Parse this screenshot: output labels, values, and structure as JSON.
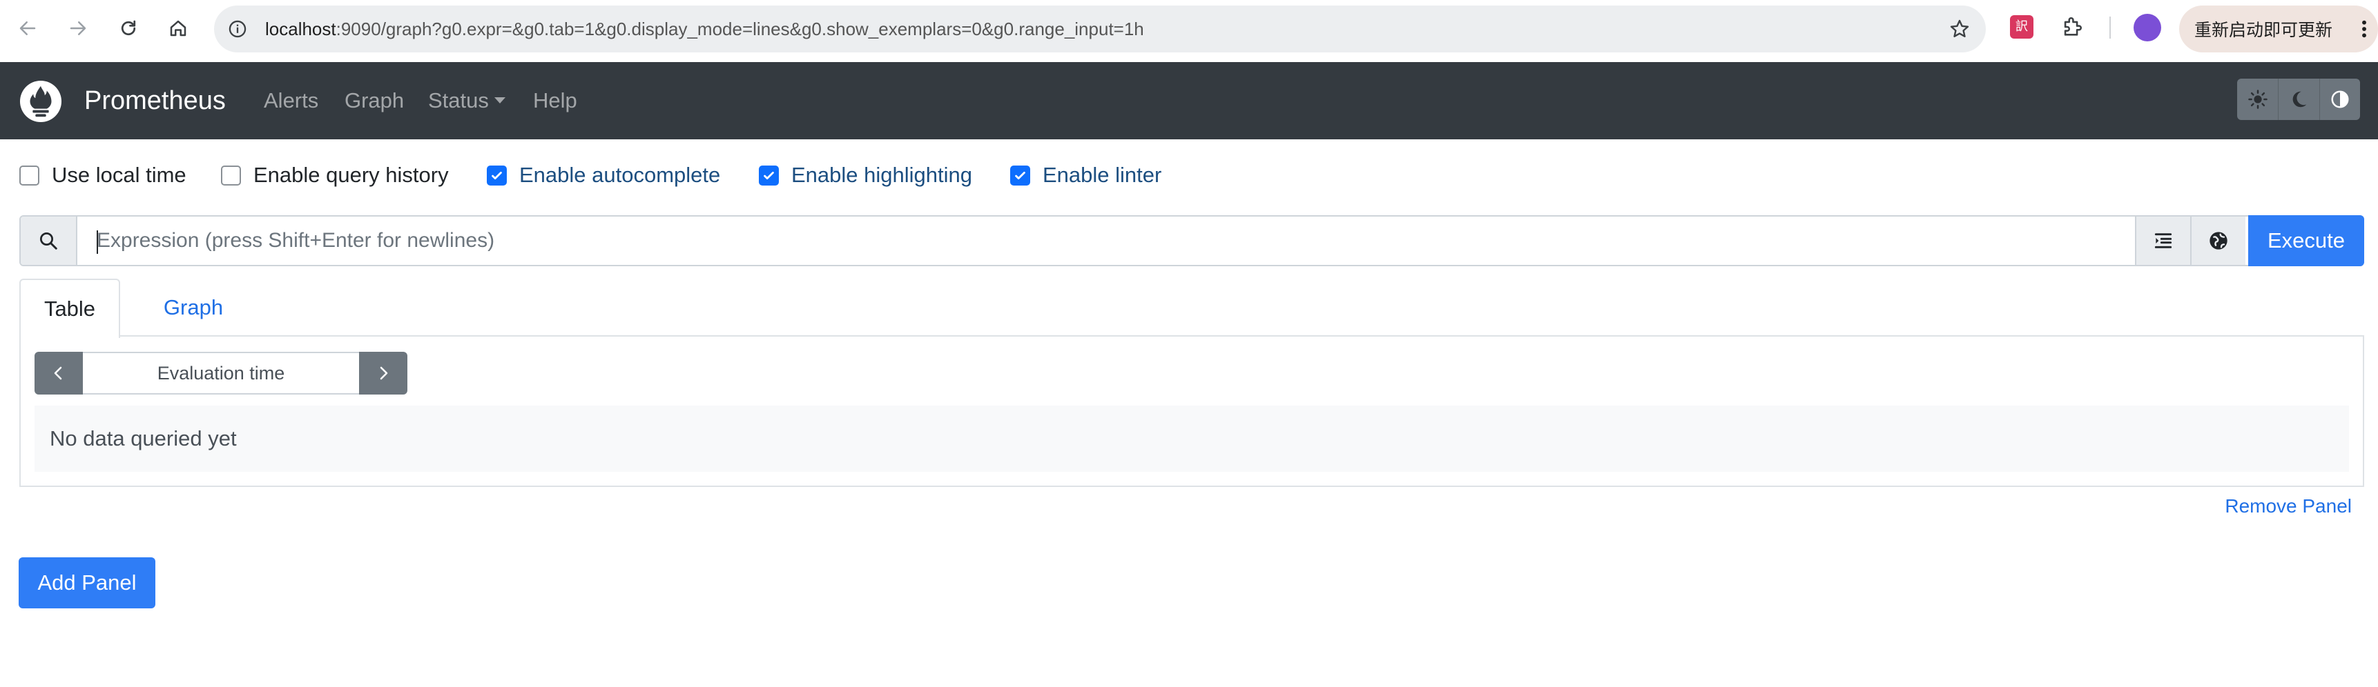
{
  "browser": {
    "url_host": "localhost",
    "url_rest": ":9090/graph?g0.expr=&g0.tab=1&g0.display_mode=lines&g0.show_exemplars=0&g0.range_input=1h",
    "translate_ext_label": "訳",
    "update_button": "重新启动即可更新",
    "icons": [
      "back-icon",
      "forward-icon",
      "reload-icon",
      "home-icon",
      "info-icon",
      "star-icon",
      "translate-icon",
      "puzzle-icon",
      "profile-avatar",
      "more-icon"
    ]
  },
  "navbar": {
    "brand": "Prometheus",
    "links": [
      "Alerts",
      "Graph",
      "Status",
      "Help"
    ],
    "theme_buttons": [
      "sun-icon",
      "moon-icon",
      "contrast-icon"
    ],
    "bg_color": "#343a40"
  },
  "settings": [
    {
      "label": "Use local time",
      "checked": false
    },
    {
      "label": "Enable query history",
      "checked": false
    },
    {
      "label": "Enable autocomplete",
      "checked": true
    },
    {
      "label": "Enable highlighting",
      "checked": true
    },
    {
      "label": "Enable linter",
      "checked": true
    }
  ],
  "query": {
    "placeholder": "Expression (press Shift+Enter for newlines)",
    "value": "",
    "execute_label": "Execute",
    "tool_icons": [
      "format-icon",
      "metrics-explorer-icon"
    ]
  },
  "tabs": {
    "table": "Table",
    "graph": "Graph",
    "active": "Table"
  },
  "panel": {
    "eval_time_placeholder": "Evaluation time",
    "no_data": "No data queried yet",
    "remove_label": "Remove Panel"
  },
  "add_panel_label": "Add Panel",
  "accent_color": "#0d6efd"
}
